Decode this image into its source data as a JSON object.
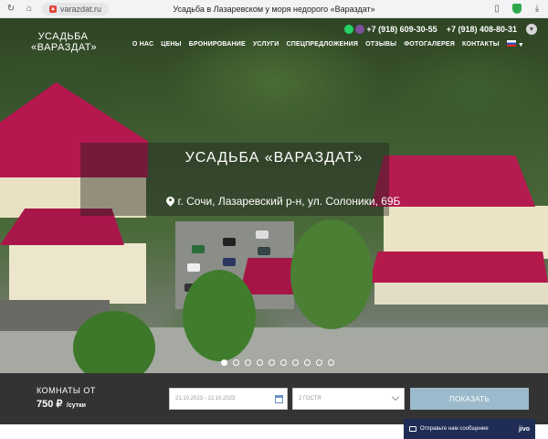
{
  "browser": {
    "url": "varazdat.ru",
    "page_title": "Усадьба в Лазаревском у моря недорого «Вараздат»"
  },
  "header": {
    "logo_line1": "УСАДЬБА",
    "logo_line2": "«ВАРАЗДАТ»",
    "phone1": "+7 (918) 609-30-55",
    "phone2": "+7 (918) 408-80-31"
  },
  "nav": {
    "items": [
      "О НАС",
      "ЦЕНЫ",
      "БРОНИРОВАНИЕ",
      "УСЛУГИ",
      "СПЕЦПРЕДЛОЖЕНИЯ",
      "ОТЗЫВЫ",
      "ФОТОГАЛЕРЕЯ",
      "КОНТАКТЫ"
    ]
  },
  "hero": {
    "title": "УСАДЬБА «ВАРАЗДАТ»",
    "address": "г. Сочи, Лазаревский р-н, ул. Солоники, 69Б",
    "slides_count": 10,
    "active_slide": 1
  },
  "booking": {
    "price_label": "КОМНАТЫ ОТ",
    "price_value": "750 ₽",
    "price_unit": "/сутки",
    "dates_placeholder": "21.10.2023 - 22.10.2023",
    "guests_value": "2 ГОСТЯ",
    "show_button": "ПОКАЗАТЬ"
  },
  "chat": {
    "label": "Отправьте нам сообщение",
    "brand": "jivo"
  },
  "colors": {
    "roof": "#b5174f",
    "booking_bar": "#333333",
    "button": "#9bbacb",
    "chat_bg": "#1f2d56"
  }
}
